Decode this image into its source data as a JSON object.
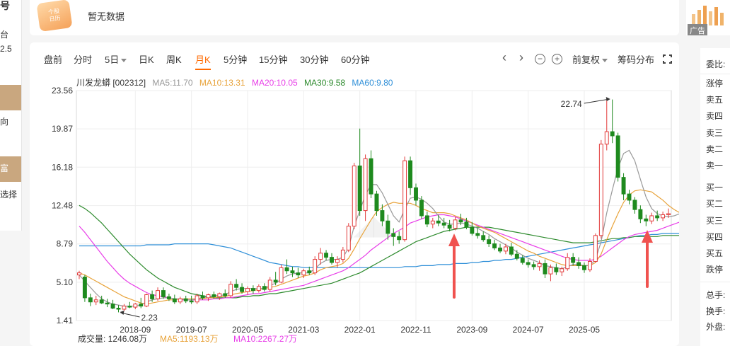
{
  "left_panel": {
    "t1": "号",
    "t2": "台",
    "t3": "2.5",
    "t4": "向",
    "t5": "富",
    "t6": "选择"
  },
  "notice": {
    "icon_line1": "个股",
    "icon_line2": "日历",
    "text": "暂无数据"
  },
  "ad": {
    "label": "广告"
  },
  "toolbar": {
    "tabs": [
      "盘前",
      "分时",
      "5日",
      "日K",
      "周K",
      "月K",
      "5分钟",
      "15分钟",
      "30分钟",
      "60分钟"
    ],
    "active_tab": "月K",
    "prev": "‹",
    "next": "›",
    "zoom_out": "−",
    "zoom_in": "+",
    "adjust": "前复权",
    "chip": "筹码分布"
  },
  "ma": {
    "stock": "川发龙蟒 [002312]",
    "ma5": "MA5:11.70",
    "ma10": "MA10:13.31",
    "ma20": "MA20:10.05",
    "ma30": "MA30:9.58",
    "ma60": "MA60:9.80",
    "colors": {
      "ma5": "#999999",
      "ma10": "#e8a33a",
      "ma20": "#e83ee8",
      "ma30": "#2e8b2e",
      "ma60": "#2f8fd8"
    }
  },
  "volume": {
    "label": "成交量: 1246.08万",
    "ma5": "MA5:1193.13万",
    "ma10": "MA10:2267.27万"
  },
  "chart_data": {
    "type": "candlestick",
    "y_ticks": [
      "23.56",
      "19.87",
      "16.18",
      "12.48",
      "8.79",
      "5.10",
      "1.41"
    ],
    "x_ticks": [
      "2018-09",
      "2019-07",
      "2020-05",
      "2021-03",
      "2022-01",
      "2022-11",
      "2023-09",
      "2024-07",
      "2025-05"
    ],
    "ylim": [
      1.41,
      23.56
    ],
    "annotations": [
      {
        "text": "22.74",
        "value": 22.74
      },
      {
        "text": "2.23",
        "value": 2.23
      }
    ],
    "candles": [
      [
        5.8,
        6.2,
        5.4,
        6.0
      ],
      [
        5.6,
        5.8,
        3.2,
        3.6
      ],
      [
        3.6,
        4.0,
        2.8,
        3.2
      ],
      [
        3.2,
        3.8,
        2.9,
        3.4
      ],
      [
        3.4,
        3.8,
        3.0,
        3.1
      ],
      [
        3.1,
        3.5,
        2.7,
        3.0
      ],
      [
        3.0,
        3.4,
        2.5,
        2.6
      ],
      [
        2.6,
        2.9,
        2.2,
        2.5
      ],
      [
        2.5,
        3.0,
        2.3,
        2.8
      ],
      [
        2.8,
        3.2,
        2.6,
        2.7
      ],
      [
        2.7,
        3.1,
        2.5,
        3.0
      ],
      [
        3.0,
        3.6,
        2.6,
        2.8
      ],
      [
        2.8,
        4.0,
        2.7,
        3.9
      ],
      [
        3.9,
        4.3,
        3.2,
        3.5
      ],
      [
        3.5,
        4.6,
        3.3,
        4.3
      ],
      [
        4.3,
        4.6,
        3.5,
        3.7
      ],
      [
        3.7,
        4.0,
        3.3,
        3.5
      ],
      [
        3.5,
        3.9,
        3.0,
        3.2
      ],
      [
        3.2,
        3.7,
        3.0,
        3.5
      ],
      [
        3.5,
        3.8,
        3.1,
        3.3
      ],
      [
        3.3,
        3.8,
        3.0,
        3.2
      ],
      [
        3.2,
        4.0,
        3.0,
        3.8
      ],
      [
        3.8,
        4.2,
        3.4,
        3.6
      ],
      [
        3.6,
        4.0,
        3.3,
        3.9
      ],
      [
        3.9,
        4.2,
        3.5,
        3.7
      ],
      [
        3.7,
        4.1,
        3.4,
        4.0
      ],
      [
        4.0,
        4.4,
        3.6,
        3.8
      ],
      [
        3.8,
        5.2,
        3.6,
        4.9
      ],
      [
        4.9,
        5.4,
        4.3,
        4.6
      ],
      [
        4.6,
        5.0,
        4.0,
        4.2
      ],
      [
        4.2,
        4.7,
        3.9,
        4.5
      ],
      [
        4.5,
        4.8,
        4.0,
        4.3
      ],
      [
        4.3,
        4.9,
        4.1,
        4.7
      ],
      [
        4.7,
        5.0,
        4.2,
        4.4
      ],
      [
        4.4,
        5.6,
        4.2,
        5.3
      ],
      [
        5.3,
        6.1,
        4.8,
        5.1
      ],
      [
        5.1,
        6.8,
        5.0,
        6.5
      ],
      [
        6.5,
        7.3,
        5.9,
        6.2
      ],
      [
        6.2,
        6.6,
        5.6,
        6.0
      ],
      [
        6.0,
        6.5,
        5.5,
        5.8
      ],
      [
        5.8,
        6.4,
        5.5,
        6.2
      ],
      [
        6.2,
        6.6,
        5.8,
        6.0
      ],
      [
        6.0,
        7.6,
        5.8,
        7.3
      ],
      [
        7.3,
        8.4,
        6.8,
        7.9
      ],
      [
        7.9,
        8.2,
        7.2,
        7.5
      ],
      [
        7.5,
        7.9,
        6.8,
        7.0
      ],
      [
        7.0,
        7.6,
        6.5,
        7.3
      ],
      [
        7.3,
        8.5,
        7.0,
        8.2
      ],
      [
        8.2,
        10.8,
        8.0,
        10.5
      ],
      [
        10.5,
        16.6,
        10.2,
        16.3
      ],
      [
        16.3,
        19.9,
        11.5,
        12.0
      ],
      [
        12.0,
        17.4,
        11.0,
        17.0
      ],
      [
        17.0,
        17.8,
        13.2,
        13.6
      ],
      [
        13.6,
        13.9,
        11.5,
        12.0
      ],
      [
        12.0,
        12.6,
        10.5,
        11.0
      ],
      [
        11.0,
        11.6,
        9.2,
        9.8
      ],
      [
        9.8,
        10.3,
        8.6,
        9.5
      ],
      [
        9.5,
        10.0,
        8.8,
        9.2
      ],
      [
        9.2,
        17.2,
        9.0,
        16.8
      ],
      [
        16.8,
        17.2,
        13.5,
        14.2
      ],
      [
        14.2,
        14.6,
        12.5,
        13.0
      ],
      [
        13.0,
        13.4,
        11.2,
        11.5
      ],
      [
        11.5,
        11.9,
        10.4,
        10.7
      ],
      [
        10.7,
        11.3,
        10.3,
        11.0
      ],
      [
        11.0,
        11.6,
        10.5,
        10.8
      ],
      [
        10.8,
        11.3,
        10.3,
        10.6
      ],
      [
        10.6,
        11.1,
        10.0,
        10.3
      ],
      [
        10.3,
        11.4,
        10.1,
        11.1
      ],
      [
        11.1,
        11.7,
        10.6,
        10.9
      ],
      [
        10.9,
        11.3,
        10.2,
        10.4
      ],
      [
        10.4,
        10.9,
        9.6,
        9.8
      ],
      [
        9.8,
        10.3,
        9.3,
        9.6
      ],
      [
        9.6,
        10.0,
        9.0,
        9.2
      ],
      [
        9.2,
        9.6,
        8.5,
        8.8
      ],
      [
        8.8,
        9.2,
        8.2,
        8.4
      ],
      [
        8.4,
        8.8,
        7.9,
        8.1
      ],
      [
        8.1,
        8.8,
        7.8,
        8.5
      ],
      [
        8.5,
        8.9,
        7.6,
        7.8
      ],
      [
        7.8,
        8.2,
        7.2,
        7.4
      ],
      [
        7.4,
        7.7,
        6.8,
        7.0
      ],
      [
        7.0,
        7.3,
        6.5,
        6.8
      ],
      [
        6.8,
        7.1,
        6.3,
        6.6
      ],
      [
        6.6,
        7.2,
        6.2,
        6.9
      ],
      [
        6.9,
        7.3,
        5.5,
        5.9
      ],
      [
        5.9,
        6.8,
        5.2,
        6.5
      ],
      [
        6.5,
        6.9,
        5.8,
        6.1
      ],
      [
        6.1,
        6.6,
        5.7,
        6.4
      ],
      [
        6.4,
        7.9,
        6.2,
        7.5
      ],
      [
        7.5,
        7.9,
        6.7,
        7.0
      ],
      [
        7.0,
        7.5,
        6.4,
        6.7
      ],
      [
        6.7,
        7.0,
        6.0,
        6.3
      ],
      [
        6.3,
        7.4,
        6.1,
        7.1
      ],
      [
        7.1,
        9.8,
        7.0,
        9.6
      ],
      [
        9.6,
        18.8,
        9.3,
        18.4
      ],
      [
        18.4,
        22.7,
        17.8,
        19.6
      ],
      [
        19.6,
        22.7,
        18.5,
        19.2
      ],
      [
        19.2,
        19.5,
        14.8,
        15.2
      ],
      [
        15.2,
        15.6,
        13.0,
        13.6
      ],
      [
        13.6,
        14.0,
        12.6,
        13.0
      ],
      [
        13.0,
        13.3,
        11.7,
        12.1
      ],
      [
        12.1,
        12.5,
        10.8,
        11.2
      ],
      [
        11.2,
        11.6,
        10.5,
        11.0
      ],
      [
        11.0,
        11.8,
        10.7,
        11.5
      ],
      [
        11.5,
        12.0,
        11.0,
        11.3
      ],
      [
        11.3,
        11.9,
        11.0,
        11.6
      ],
      [
        11.6,
        12.2,
        11.3,
        11.7
      ]
    ],
    "ma5": [
      5.8,
      5.2,
      4.6,
      4.0,
      3.5,
      3.2,
      3.0,
      2.9,
      2.8,
      2.8,
      2.8,
      2.9,
      3.2,
      3.4,
      3.5,
      3.6,
      3.6,
      3.5,
      3.5,
      3.4,
      3.4,
      3.5,
      3.6,
      3.7,
      3.8,
      3.8,
      3.9,
      4.2,
      4.4,
      4.5,
      4.5,
      4.5,
      4.5,
      4.5,
      4.8,
      5.0,
      5.4,
      5.7,
      5.9,
      6.0,
      6.0,
      6.0,
      6.4,
      6.9,
      7.2,
      7.3,
      7.3,
      7.5,
      8.4,
      10.5,
      12.0,
      13.5,
      14.5,
      14.5,
      13.7,
      12.6,
      11.5,
      10.9,
      12.1,
      13.2,
      13.3,
      13.1,
      12.7,
      12.2,
      11.5,
      10.9,
      10.7,
      10.7,
      10.8,
      10.7,
      10.5,
      10.3,
      10.0,
      9.7,
      9.3,
      9.0,
      8.7,
      8.4,
      8.0,
      7.7,
      7.4,
      7.2,
      7.0,
      6.7,
      6.6,
      6.5,
      6.4,
      6.6,
      6.8,
      6.8,
      6.7,
      6.7,
      7.3,
      9.0,
      11.8,
      14.0,
      16.1,
      17.5,
      17.8,
      16.8,
      15.0,
      13.3,
      12.2,
      11.7,
      11.5,
      11.4,
      11.5,
      11.7
    ],
    "ma10": [
      6.0,
      5.8,
      5.5,
      5.2,
      4.9,
      4.6,
      4.3,
      4.0,
      3.7,
      3.5,
      3.3,
      3.1,
      3.0,
      3.1,
      3.2,
      3.3,
      3.4,
      3.4,
      3.5,
      3.5,
      3.5,
      3.5,
      3.5,
      3.6,
      3.6,
      3.7,
      3.7,
      3.9,
      4.0,
      4.1,
      4.2,
      4.3,
      4.4,
      4.5,
      4.6,
      4.7,
      4.9,
      5.1,
      5.3,
      5.5,
      5.7,
      5.8,
      6.0,
      6.3,
      6.5,
      6.6,
      6.7,
      6.9,
      7.4,
      8.3,
      9.3,
      10.2,
      11.1,
      11.9,
      12.3,
      12.6,
      12.8,
      12.7,
      12.7,
      12.7,
      12.5,
      12.2,
      12.0,
      11.8,
      11.8,
      11.8,
      11.7,
      11.5,
      11.3,
      11.1,
      10.8,
      10.5,
      10.3,
      10.1,
      9.9,
      9.6,
      9.3,
      9.0,
      8.7,
      8.4,
      8.1,
      7.9,
      7.6,
      7.4,
      7.2,
      7.0,
      6.8,
      6.7,
      6.7,
      6.7,
      6.7,
      6.7,
      7.0,
      7.8,
      9.2,
      10.5,
      11.7,
      12.8,
      13.5,
      13.9,
      14.0,
      13.9,
      13.8,
      13.4,
      13.0,
      12.5,
      12.1,
      11.8
    ],
    "ma20": [
      10.5,
      9.9,
      9.2,
      8.5,
      7.8,
      7.1,
      6.5,
      5.9,
      5.4,
      5.0,
      4.7,
      4.4,
      4.1,
      3.9,
      3.8,
      3.7,
      3.6,
      3.5,
      3.4,
      3.4,
      3.4,
      3.4,
      3.4,
      3.4,
      3.5,
      3.5,
      3.6,
      3.6,
      3.7,
      3.8,
      3.9,
      4.0,
      4.0,
      4.1,
      4.2,
      4.3,
      4.4,
      4.5,
      4.6,
      4.7,
      4.8,
      5.0,
      5.2,
      5.4,
      5.6,
      5.8,
      6.0,
      6.2,
      6.5,
      6.9,
      7.3,
      7.7,
      8.2,
      8.6,
      9.0,
      9.4,
      9.8,
      10.1,
      10.4,
      10.8,
      11.0,
      11.2,
      11.4,
      11.5,
      11.6,
      11.6,
      11.5,
      11.4,
      11.2,
      11.0,
      10.8,
      10.6,
      10.4,
      10.2,
      10.0,
      9.8,
      9.6,
      9.4,
      9.2,
      9.0,
      8.8,
      8.6,
      8.4,
      8.2,
      8.0,
      7.8,
      7.6,
      7.4,
      7.3,
      7.2,
      7.2,
      7.2,
      7.3,
      7.6,
      8.0,
      8.4,
      8.8,
      9.2,
      9.5,
      9.7,
      9.8,
      9.9,
      10.0,
      10.1,
      10.3,
      10.5,
      10.7,
      10.9
    ],
    "ma30": [
      12.5,
      12.2,
      11.8,
      11.3,
      10.8,
      10.2,
      9.6,
      9.0,
      8.4,
      7.8,
      7.3,
      6.8,
      6.3,
      5.9,
      5.5,
      5.2,
      4.9,
      4.6,
      4.4,
      4.2,
      4.0,
      3.9,
      3.8,
      3.7,
      3.6,
      3.6,
      3.6,
      3.6,
      3.6,
      3.7,
      3.7,
      3.8,
      3.8,
      3.9,
      4.0,
      4.0,
      4.1,
      4.2,
      4.3,
      4.4,
      4.5,
      4.6,
      4.7,
      4.8,
      4.9,
      5.0,
      5.2,
      5.4,
      5.6,
      5.8,
      6.0,
      6.3,
      6.6,
      6.9,
      7.2,
      7.5,
      7.8,
      8.1,
      8.4,
      8.7,
      9.0,
      9.2,
      9.4,
      9.6,
      9.8,
      10.0,
      10.1,
      10.2,
      10.3,
      10.4,
      10.4,
      10.4,
      10.4,
      10.4,
      10.3,
      10.2,
      10.1,
      10.0,
      9.9,
      9.8,
      9.7,
      9.6,
      9.5,
      9.4,
      9.3,
      9.2,
      9.1,
      9.0,
      8.9,
      8.9,
      8.9,
      8.9,
      9.0,
      9.1,
      9.2,
      9.3,
      9.3,
      9.4,
      9.4,
      9.5,
      9.5,
      9.5,
      9.5,
      9.5,
      9.6,
      9.6,
      9.6,
      9.6
    ],
    "ma60": [
      8.6,
      8.6,
      8.6,
      8.6,
      8.6,
      8.6,
      8.6,
      8.6,
      8.6,
      8.6,
      8.6,
      8.6,
      8.7,
      8.7,
      8.7,
      8.7,
      8.7,
      8.8,
      8.8,
      8.8,
      8.8,
      8.8,
      8.8,
      8.8,
      8.7,
      8.6,
      8.5,
      8.4,
      8.2,
      8.0,
      7.8,
      7.6,
      7.4,
      7.2,
      7.0,
      6.9,
      6.8,
      6.7,
      6.6,
      6.6,
      6.5,
      6.5,
      6.5,
      6.5,
      6.5,
      6.5,
      6.5,
      6.5,
      6.5,
      6.5,
      6.5,
      6.5,
      6.5,
      6.5,
      6.5,
      6.5,
      6.5,
      6.5,
      6.6,
      6.6,
      6.6,
      6.7,
      6.7,
      6.7,
      6.8,
      6.8,
      6.8,
      6.9,
      6.9,
      6.9,
      7.0,
      7.0,
      7.1,
      7.1,
      7.2,
      7.2,
      7.3,
      7.3,
      7.4,
      7.5,
      7.6,
      7.7,
      7.8,
      7.9,
      8.0,
      8.1,
      8.2,
      8.3,
      8.4,
      8.5,
      8.6,
      8.7,
      8.8,
      8.9,
      9.0,
      9.1,
      9.2,
      9.3,
      9.4,
      9.5,
      9.6,
      9.6,
      9.7,
      9.7,
      9.8,
      9.8,
      9.8,
      9.8
    ]
  },
  "right_panel": {
    "title": "委比:",
    "items": [
      "涨停",
      "卖五",
      "卖四",
      "卖三",
      "卖二",
      "卖一",
      "买一",
      "买二",
      "买三",
      "买四",
      "买五",
      "跌停"
    ],
    "bottom": [
      "总手:",
      "换手:",
      "外盘:"
    ]
  }
}
